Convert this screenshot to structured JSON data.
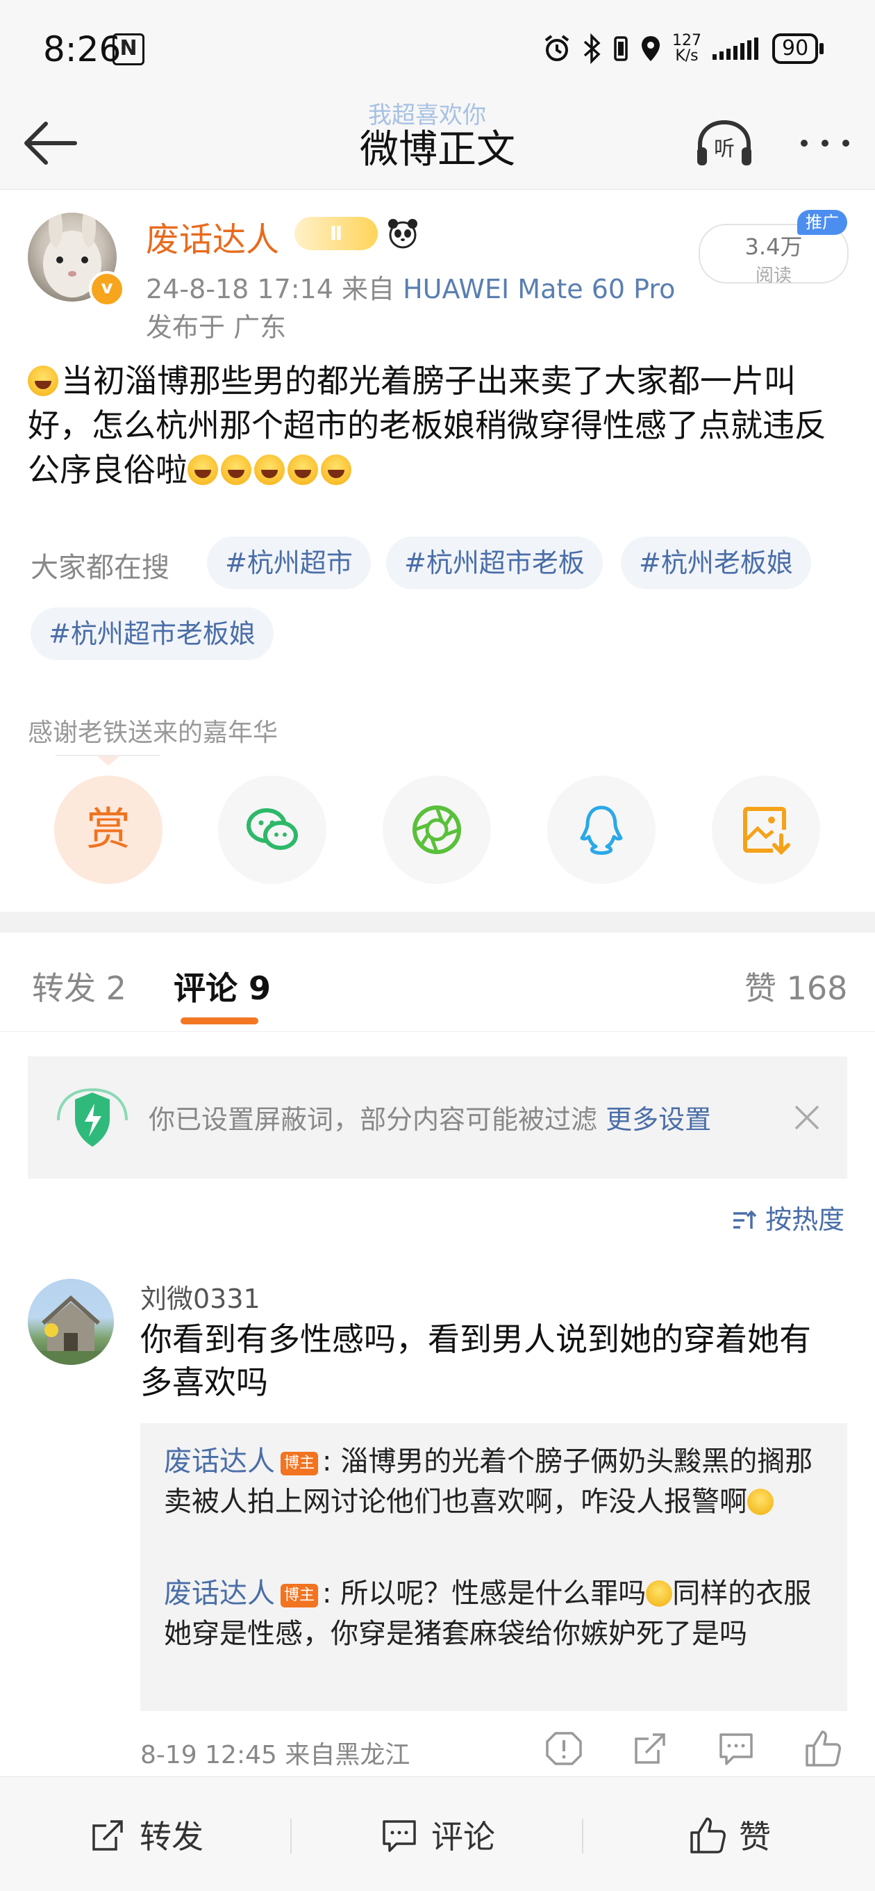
{
  "status_bar": {
    "time": "8:26",
    "nfc": "N",
    "net_speed_value": "127",
    "net_speed_unit": "K/s",
    "battery": "90"
  },
  "nav": {
    "subtitle": "我超喜欢你",
    "title": "微博正文"
  },
  "post": {
    "username": "废话达人",
    "level_badge": "Ⅱ",
    "verified_mark": "v",
    "date": "24-8-18 17:14",
    "source_prefix": "来自",
    "device": "HUAWEI Mate 60 Pro",
    "location": "发布于 广东",
    "reads": "3.4万",
    "reads_label": "阅读",
    "promo": "推广",
    "content": "当初淄博那些男的都光着膀子出来卖了大家都一片叫好，怎么杭州那个超市的老板娘稍微穿得性感了点就违反公序良俗啦"
  },
  "search": {
    "label": "大家都在搜",
    "tags": [
      "#杭州超市",
      "#杭州超市老板",
      "#杭州老板娘",
      "#杭州超市老板娘"
    ]
  },
  "thanks": "感谢老铁送来的嘉年华",
  "share": {
    "reward_label": "赏",
    "icons": [
      "reward-icon",
      "wechat-icon",
      "moments-icon",
      "qq-icon",
      "save-image-icon"
    ]
  },
  "tabs": {
    "repost": "转发 2",
    "comment": "评论 9",
    "like": "赞 168"
  },
  "notice": {
    "text": "你已设置屏蔽词，部分内容可能被过滤",
    "link": "更多设置"
  },
  "sort": "按热度",
  "comment": {
    "name": "刘微0331",
    "text": "你看到有多性感吗，看到男人说到她的穿着她有多喜欢吗",
    "replies": [
      {
        "name": "废话达人",
        "badge": "博主",
        "text": "淄博男的光着个膀子俩奶头黢黑的搁那卖被人拍上网讨论他们也喜欢啊，咋没人报警啊"
      },
      {
        "name": "废话达人",
        "badge": "博主",
        "text_a": "所以呢？性感是什么罪吗",
        "text_b": "同样的衣服她穿是性感，你穿是猪套麻袋给你嫉妒死了是吗"
      }
    ],
    "time": "8-19 12:45",
    "location": "来自黑龙江"
  },
  "bottom": {
    "repost": "转发",
    "comment": "评论",
    "like": "赞"
  },
  "colors": {
    "accent": "#f37723",
    "link": "#4a6ea8",
    "username": "#e86b1e"
  }
}
